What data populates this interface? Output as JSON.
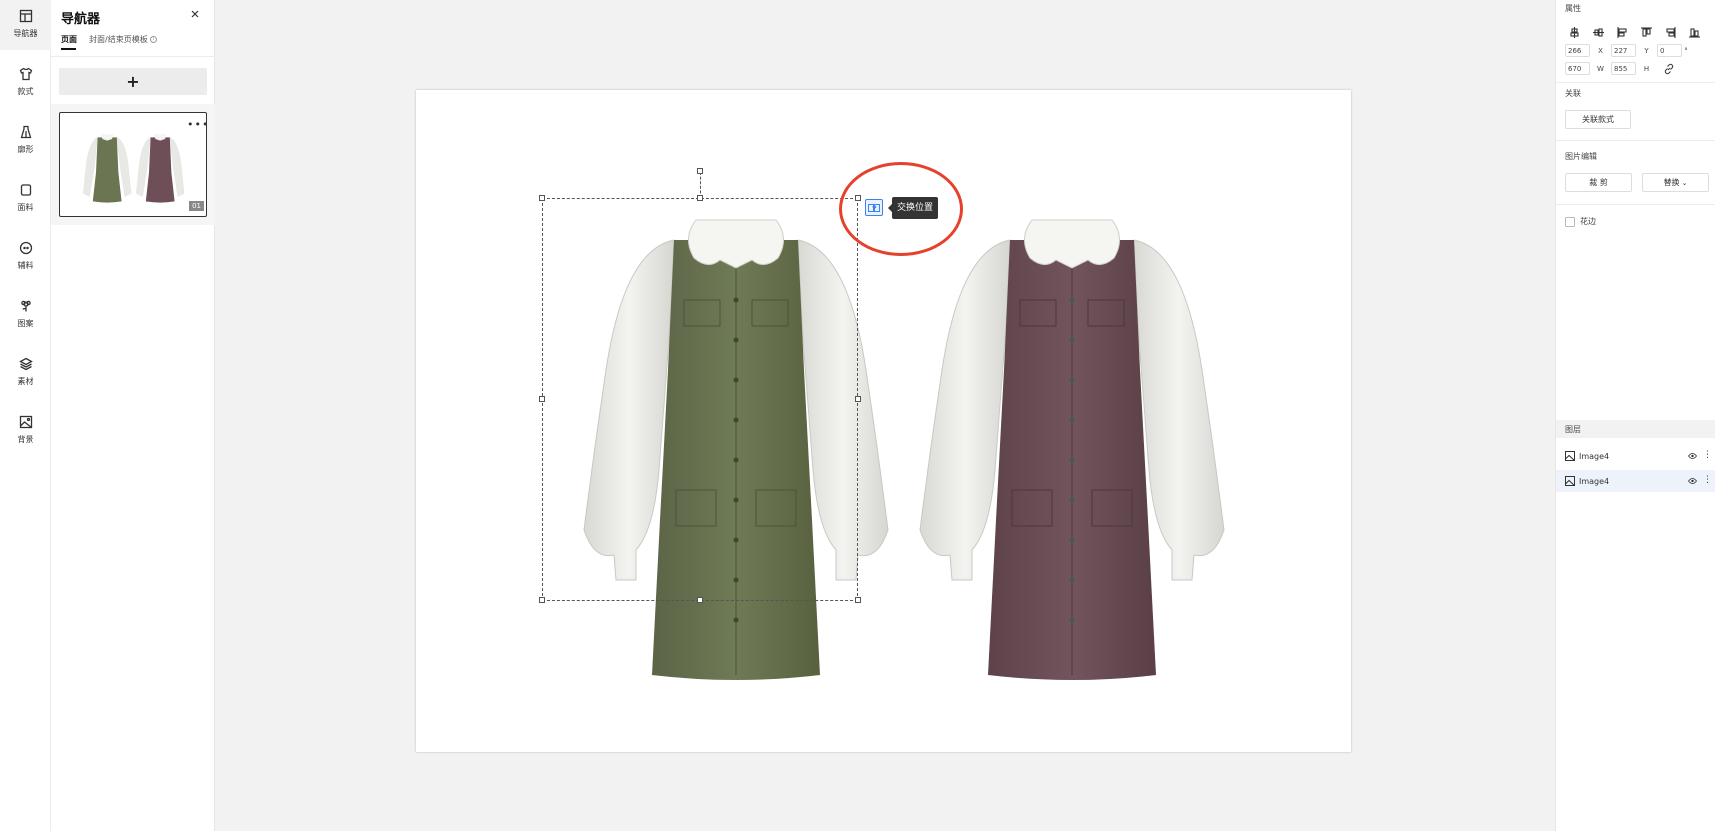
{
  "sidebar": {
    "items": [
      {
        "label": "导航器",
        "icon": "layout-icon"
      },
      {
        "label": "款式",
        "icon": "shirt-icon"
      },
      {
        "label": "廓形",
        "icon": "silhouette-icon"
      },
      {
        "label": "面料",
        "icon": "fabric-icon"
      },
      {
        "label": "辅料",
        "icon": "button-icon"
      },
      {
        "label": "图案",
        "icon": "flower-icon"
      },
      {
        "label": "素材",
        "icon": "layers-icon"
      },
      {
        "label": "背景",
        "icon": "image-icon"
      }
    ]
  },
  "navigator": {
    "title": "导航器",
    "tabs": [
      {
        "label": "页面",
        "active": true
      },
      {
        "label": "封面/结束页模板",
        "active": false
      }
    ],
    "add_label": "+",
    "pages": [
      {
        "number": "01"
      }
    ]
  },
  "canvas": {
    "dresses": [
      {
        "name": "olive-dress",
        "color": "#6b7552"
      },
      {
        "name": "mauve-dress",
        "color": "#6e4f57"
      }
    ],
    "tooltip": "交换位置"
  },
  "properties": {
    "title": "属性",
    "position": {
      "x": "266",
      "x_label": "X",
      "y": "227",
      "y_label": "Y",
      "rotation": "0",
      "rotation_unit": "°"
    },
    "size": {
      "w": "670",
      "w_label": "W",
      "h": "855",
      "h_label": "H"
    },
    "link_section": {
      "title": "关联",
      "button": "关联款式"
    },
    "image_edit": {
      "title": "图片编辑",
      "crop": "裁 剪",
      "replace": "替换"
    },
    "checkbox_label": "花边"
  },
  "layers": {
    "title": "图层",
    "items": [
      {
        "name": "Image4",
        "selected": false
      },
      {
        "name": "Image4",
        "selected": true
      }
    ]
  },
  "colors": {
    "accent": "#3b82f6",
    "highlight_circle": "#e5412c",
    "tooltip_bg": "#333333"
  }
}
